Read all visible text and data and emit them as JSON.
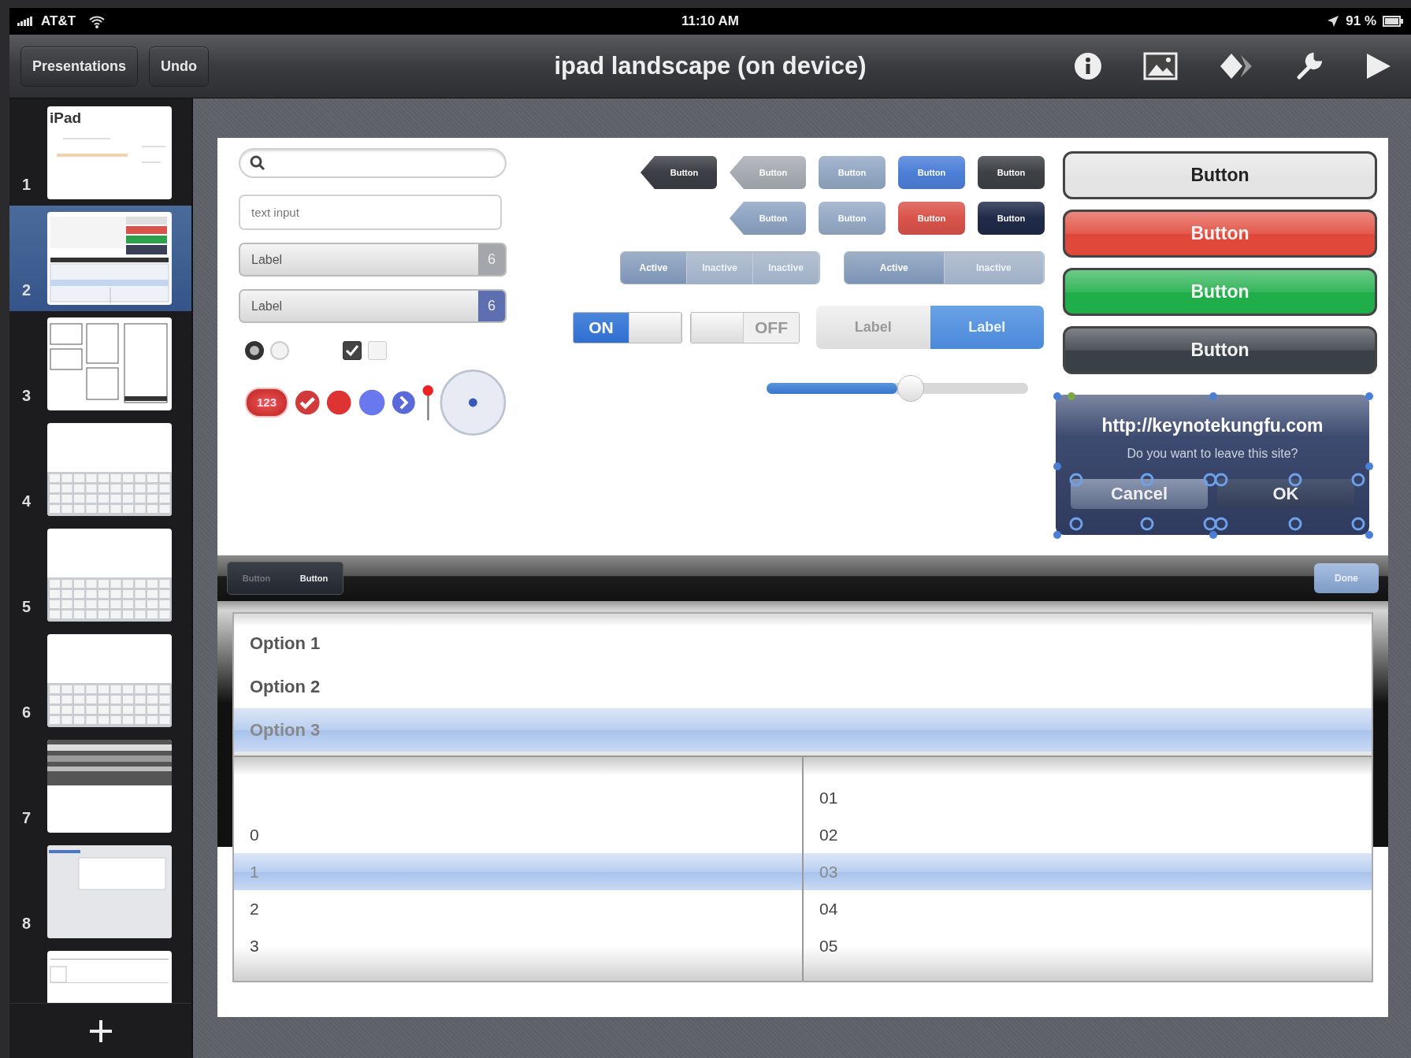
{
  "status_bar": {
    "carrier": "AT&T",
    "time": "11:10 AM",
    "battery": "91 %"
  },
  "toolbar": {
    "buttons": [
      {
        "label": "Presentations"
      },
      {
        "label": "Undo"
      }
    ],
    "title": "ipad landscape (on device)"
  },
  "slides": [
    {
      "number": "1",
      "selected": false,
      "kind": "title",
      "title": "iPad"
    },
    {
      "number": "2",
      "selected": true,
      "kind": "controls"
    },
    {
      "number": "3",
      "selected": false,
      "kind": "lists"
    },
    {
      "number": "4",
      "selected": false,
      "kind": "keyboard"
    },
    {
      "number": "5",
      "selected": false,
      "kind": "keyboard"
    },
    {
      "number": "6",
      "selected": false,
      "kind": "keyboard"
    },
    {
      "number": "7",
      "selected": false,
      "kind": "bars"
    },
    {
      "number": "8",
      "selected": false,
      "kind": "table"
    },
    {
      "selected": false,
      "kind": "form"
    }
  ],
  "canvas": {
    "text_input": {
      "placeholder": "text input"
    },
    "label_rows": [
      {
        "label": "Label",
        "badge": "6",
        "selected": false
      },
      {
        "label": "Label",
        "badge": "6",
        "selected": true
      }
    ],
    "radios": [
      {
        "selected": true
      },
      {
        "selected": false
      }
    ],
    "checkboxes": [
      {
        "checked": true
      },
      {
        "checked": false
      }
    ],
    "count_badge": "123",
    "small_button_rows": [
      {
        "buttons": [
          {
            "label": "Button",
            "kind": "back",
            "color": "#3b3e44"
          },
          {
            "label": "Button",
            "kind": "back",
            "color": "#a7acb3"
          },
          {
            "label": "Button",
            "kind": "plain",
            "color": "#94a8c4"
          },
          {
            "label": "Button",
            "kind": "plain",
            "color": "#4d7fd8"
          },
          {
            "label": "Button",
            "kind": "plain",
            "color": "#3d4045"
          }
        ]
      },
      {
        "buttons": [
          {
            "label": "Button",
            "kind": "back",
            "color": "#8ea4c2"
          },
          {
            "label": "Button",
            "kind": "plain",
            "color": "#97abc6"
          },
          {
            "label": "Button",
            "kind": "plain",
            "color": "#d9534a"
          },
          {
            "label": "Button",
            "kind": "plain",
            "color": "#1f2a48"
          }
        ]
      }
    ],
    "segmented_controls": [
      {
        "segments": [
          {
            "label": "Active",
            "selected": true
          },
          {
            "label": "Inactive",
            "selected": false
          },
          {
            "label": "Inactive",
            "selected": false
          }
        ]
      },
      {
        "segments": [
          {
            "label": "Active",
            "selected": true
          },
          {
            "label": "Inactive",
            "selected": false
          }
        ]
      }
    ],
    "switches": [
      {
        "label": "ON",
        "on": true
      },
      {
        "label": "OFF",
        "on": false
      }
    ],
    "label_segments": [
      {
        "label": "Label",
        "selected": false
      },
      {
        "label": "Label",
        "selected": true
      }
    ],
    "slider": {
      "level": 0.5
    },
    "large_buttons": [
      {
        "label": "Button",
        "color": "#e4e4e4"
      },
      {
        "label": "Button",
        "color": "#e0483a"
      },
      {
        "label": "Button",
        "color": "#1fae4a"
      },
      {
        "label": "Button",
        "color": "#3a4048"
      }
    ],
    "alert": {
      "title": "http://keynotekungfu.com",
      "message": "Do you want to leave this site?",
      "buttons": [
        {
          "label": "Cancel"
        },
        {
          "label": "OK"
        }
      ]
    },
    "picker_toolbar": {
      "segments": [
        {
          "label": "Button",
          "selected": false
        },
        {
          "label": "Button",
          "selected": true
        }
      ],
      "done": "Done"
    },
    "option_list": [
      {
        "label": "Option 1",
        "selected": false
      },
      {
        "label": "Option 2",
        "selected": false
      },
      {
        "label": "Option 3",
        "selected": true
      }
    ],
    "picker_columns": [
      {
        "items": [
          {
            "label": "0",
            "selected": false
          },
          {
            "label": "1",
            "selected": true
          },
          {
            "label": "2",
            "selected": false
          },
          {
            "label": "3",
            "selected": false
          }
        ]
      },
      {
        "items": [
          {
            "label": "01",
            "selected": false
          },
          {
            "label": "02",
            "selected": false
          },
          {
            "label": "03",
            "selected": true
          },
          {
            "label": "04",
            "selected": false
          },
          {
            "label": "05",
            "selected": false
          }
        ]
      }
    ]
  }
}
